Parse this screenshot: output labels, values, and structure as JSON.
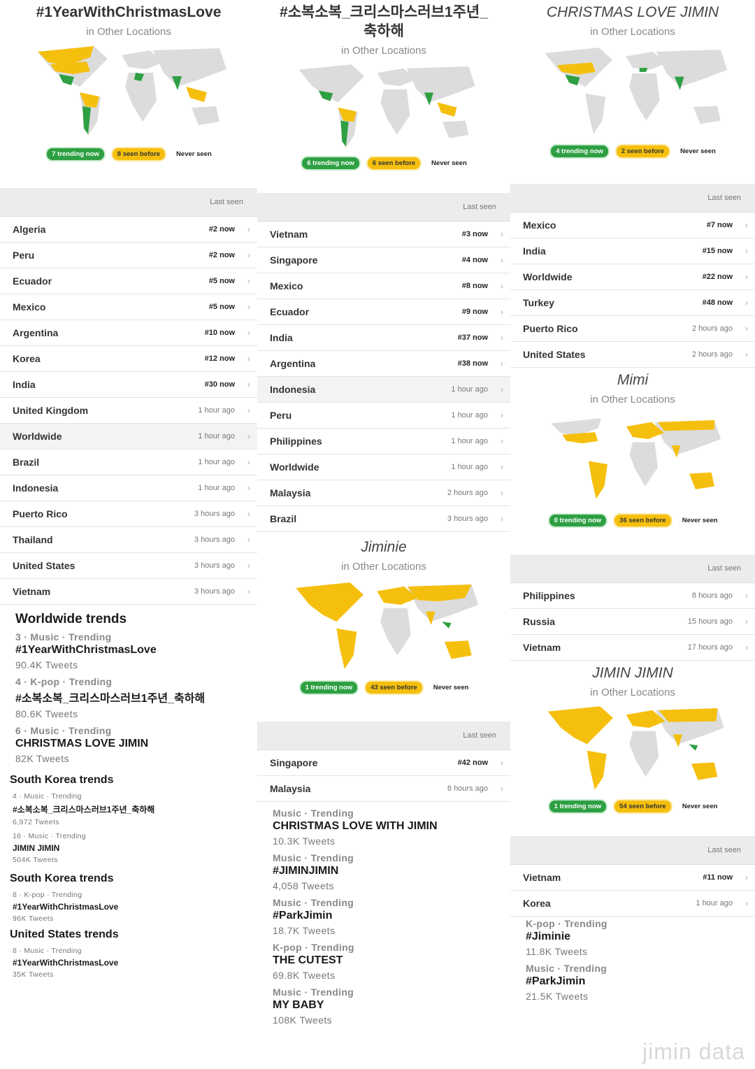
{
  "colors": {
    "trending": "#2ea043",
    "seen": "#f5bf0e",
    "never": "#dcdcdc"
  },
  "col1": {
    "title": "#1YearWithChristmasLove",
    "sub": "in Other Locations",
    "legend": {
      "trending": "7 trending now",
      "seen": "8 seen before",
      "never": "Never seen"
    },
    "lastseen": "Last seen",
    "rows": [
      {
        "loc": "Algeria",
        "rank": "#2 now"
      },
      {
        "loc": "Peru",
        "rank": "#2 now"
      },
      {
        "loc": "Ecuador",
        "rank": "#5 now"
      },
      {
        "loc": "Mexico",
        "rank": "#5 now"
      },
      {
        "loc": "Argentina",
        "rank": "#10 now"
      },
      {
        "loc": "Korea",
        "rank": "#12 now"
      },
      {
        "loc": "India",
        "rank": "#30 now"
      },
      {
        "loc": "United Kingdom",
        "ago": "1 hour ago"
      },
      {
        "loc": "Worldwide",
        "ago": "1 hour ago"
      },
      {
        "loc": "Brazil",
        "ago": "1 hour ago"
      },
      {
        "loc": "Indonesia",
        "ago": "1 hour ago"
      },
      {
        "loc": "Puerto Rico",
        "ago": "3 hours ago"
      },
      {
        "loc": "Thailand",
        "ago": "3 hours ago"
      },
      {
        "loc": "United States",
        "ago": "3 hours ago"
      },
      {
        "loc": "Vietnam",
        "ago": "3 hours ago"
      }
    ],
    "ww_title": "Worldwide trends",
    "ww": [
      {
        "meta": "3 · Music · Trending",
        "name": "#1YearWithChristmasLove",
        "cnt": "90.4K Tweets"
      },
      {
        "meta": "4 · K-pop · Trending",
        "name": "#소복소복_크리스마스러브1주년_축하해",
        "cnt": "80.6K Tweets"
      },
      {
        "meta": "6 · Music · Trending",
        "name": "CHRISTMAS LOVE JIMIN",
        "cnt": "82K Tweets"
      }
    ],
    "kr1_title": "South Korea trends",
    "kr1": [
      {
        "meta": "4 · Music · Trending",
        "name": "#소복소복_크리스마스러브1주년_축하해",
        "cnt": "6,972 Tweets"
      },
      {
        "meta": "16 · Music · Trending",
        "name": "JIMIN JIMIN",
        "cnt": "504K Tweets"
      }
    ],
    "kr2_title": "South Korea trends",
    "kr2": [
      {
        "meta": "8 · K-pop · Trending",
        "name": "#1YearWithChristmasLove",
        "cnt": "96K Tweets"
      }
    ],
    "us_title": "United States trends",
    "us": [
      {
        "meta": "8 · Music · Trending",
        "name": "#1YearWithChristmasLove",
        "cnt": "35K Tweets"
      }
    ]
  },
  "col2": {
    "title": "#소복소복_크리스마스러브1주년_축하해",
    "sub": "in Other Locations",
    "legend": {
      "trending": "6 trending now",
      "seen": "6 seen before",
      "never": "Never seen"
    },
    "lastseen": "Last seen",
    "rows": [
      {
        "loc": "Vietnam",
        "rank": "#3 now"
      },
      {
        "loc": "Singapore",
        "rank": "#4 now"
      },
      {
        "loc": "Mexico",
        "rank": "#8 now"
      },
      {
        "loc": "Ecuador",
        "rank": "#9 now"
      },
      {
        "loc": "India",
        "rank": "#37 now"
      },
      {
        "loc": "Argentina",
        "rank": "#38 now"
      },
      {
        "loc": "Indonesia",
        "ago": "1 hour ago"
      },
      {
        "loc": "Peru",
        "ago": "1 hour ago"
      },
      {
        "loc": "Philippines",
        "ago": "1 hour ago"
      },
      {
        "loc": "Worldwide",
        "ago": "1 hour ago"
      },
      {
        "loc": "Malaysia",
        "ago": "2 hours ago"
      },
      {
        "loc": "Brazil",
        "ago": "3 hours ago"
      }
    ],
    "t2": "Jiminie",
    "sub2": "in Other Locations",
    "legend2": {
      "trending": "1 trending now",
      "seen": "43 seen before",
      "never": "Never seen"
    },
    "lastseen2": "Last seen",
    "rows2": [
      {
        "loc": "Singapore",
        "rank": "#42 now"
      },
      {
        "loc": "Malaysia",
        "ago": "8 hours ago"
      }
    ],
    "trends": [
      {
        "meta": "Music · Trending",
        "name": "CHRISTMAS LOVE WITH JIMIN",
        "cnt": "10.3K Tweets"
      },
      {
        "meta": "Music · Trending",
        "name": "#JIMINJIMIN",
        "cnt": "4,058 Tweets"
      },
      {
        "meta": "Music · Trending",
        "name": "#ParkJimin",
        "cnt": "18.7K Tweets"
      },
      {
        "meta": "K-pop · Trending",
        "name": "THE CUTEST",
        "cnt": "69.8K Tweets"
      },
      {
        "meta": "Music · Trending",
        "name": "MY BABY",
        "cnt": "108K Tweets"
      }
    ]
  },
  "col3": {
    "title": "CHRISTMAS LOVE JIMIN",
    "sub": "in Other Locations",
    "legend": {
      "trending": "4 trending now",
      "seen": "2 seen before",
      "never": "Never seen"
    },
    "lastseen": "Last seen",
    "rows": [
      {
        "loc": "Mexico",
        "rank": "#7 now"
      },
      {
        "loc": "India",
        "rank": "#15 now"
      },
      {
        "loc": "Worldwide",
        "rank": "#22 now"
      },
      {
        "loc": "Turkey",
        "rank": "#48 now"
      },
      {
        "loc": "Puerto Rico",
        "ago": "2 hours ago"
      },
      {
        "loc": "United States",
        "ago": "2 hours ago"
      }
    ],
    "t2": "Mimi",
    "sub2": "in Other Locations",
    "legend2": {
      "trending": "0 trending now",
      "seen": "36 seen before",
      "never": "Never seen"
    },
    "lastseen2": "Last seen",
    "rows2": [
      {
        "loc": "Philippines",
        "ago": "8 hours ago"
      },
      {
        "loc": "Russia",
        "ago": "15 hours ago"
      },
      {
        "loc": "Vietnam",
        "ago": "17 hours ago"
      }
    ],
    "t3": "JIMIN JIMIN",
    "sub3": "in Other Locations",
    "legend3": {
      "trending": "1 trending now",
      "seen": "54 seen before",
      "never": "Never seen"
    },
    "lastseen3": "Last seen",
    "rows3": [
      {
        "loc": "Vietnam",
        "rank": "#11 now"
      },
      {
        "loc": "Korea",
        "ago": "1 hour ago"
      }
    ],
    "trends": [
      {
        "meta": "K-pop · Trending",
        "name": "#Jiminie",
        "cnt": "11.8K Tweets"
      },
      {
        "meta": "Music · Trending",
        "name": "#ParkJimin",
        "cnt": "21.5K Tweets"
      }
    ]
  },
  "watermark": "jimin data"
}
